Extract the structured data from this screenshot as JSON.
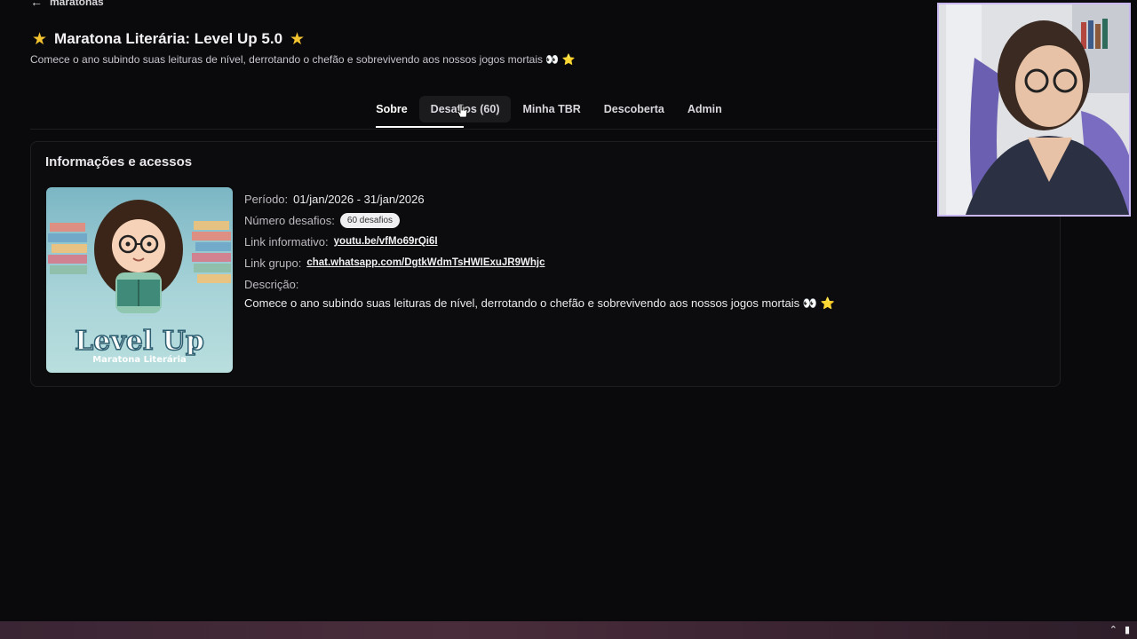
{
  "nav": {
    "back_label": "maratonas"
  },
  "header": {
    "title": "Maratona Literária: Level Up 5.0",
    "subtitle": "Comece o ano subindo suas leituras de nível, derrotando o chefão e sobrevivendo aos nossos jogos mortais",
    "subtitle_emoji": "👀 ⭐"
  },
  "tabs": [
    {
      "label": "Sobre",
      "active": true
    },
    {
      "label": "Desafios (60)"
    },
    {
      "label": "Minha TBR"
    },
    {
      "label": "Descoberta"
    },
    {
      "label": "Admin"
    }
  ],
  "card": {
    "title": "Informações e acessos",
    "cover": {
      "title": "Level Up",
      "subtitle": "Maratona Literária"
    },
    "period_label": "Período:",
    "period_value": "01/jan/2026 - 31/jan/2026",
    "challenges_label": "Número desafios:",
    "challenges_value": "60 desafios",
    "info_link_label": "Link informativo:",
    "info_link_value": "youtu.be/vfMo69rQi6I",
    "group_link_label": "Link grupo:",
    "group_link_value": "chat.whatsapp.com/DgtkWdmTsHWIExuJR9Whjc",
    "description_label": "Descrição:",
    "description_value": "Comece o ano subindo suas leituras de nível, derrotando o chefão e sobrevivendo aos nossos jogos mortais",
    "description_emoji": "👀 ⭐"
  },
  "colors": {
    "accent_star": "#f4c430",
    "webcam_border": "#c9b7f2"
  }
}
